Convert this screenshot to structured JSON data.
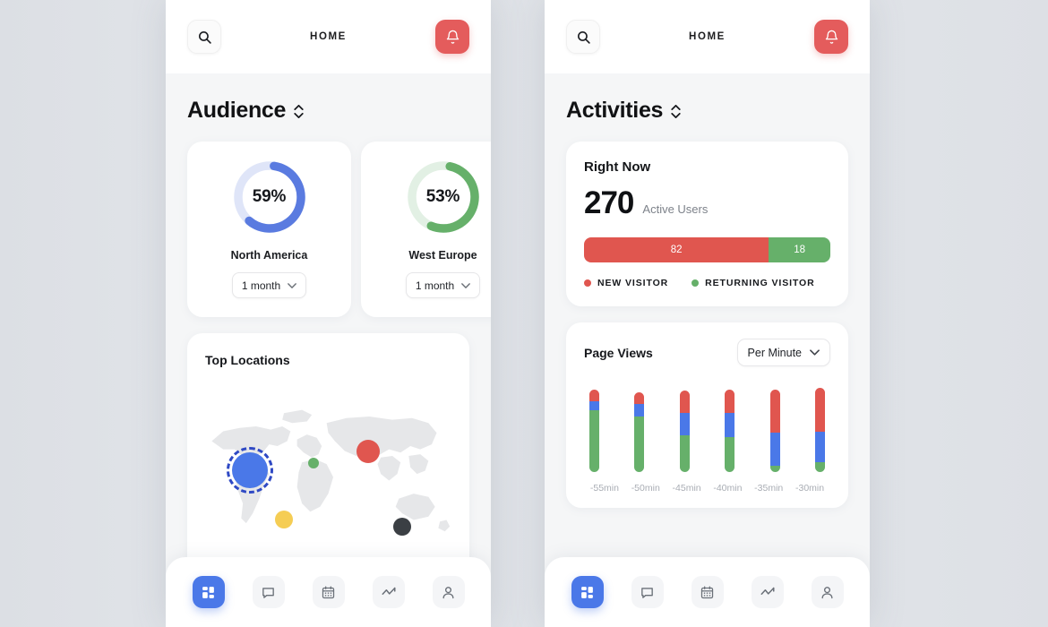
{
  "background_color": "#dfe3e7",
  "accent_colors": {
    "blue": "#5a7be0",
    "blue_track": "#dfe5f8",
    "green": "#66b06a",
    "green_track": "#e2f0e4",
    "red": "#e45c5c",
    "nav_active": "#4a78e8",
    "bar_red": "#e0564f",
    "bar_blue": "#4a78e8",
    "bar_green": "#66b06a"
  },
  "phones": [
    {
      "id": "audience-phone",
      "header": {
        "search_icon": "search-icon",
        "title": "HOME",
        "bell_icon": "bell-icon"
      },
      "section": {
        "title": "Audience",
        "sort_icon": "sort-chevrons-icon"
      },
      "donuts": [
        {
          "percent_label": "59%",
          "value": 59,
          "region": "North America",
          "period": "1 month",
          "color": "#5a7be0",
          "track": "#dfe5f8"
        },
        {
          "percent_label": "53%",
          "value": 53,
          "region": "West Europe",
          "period": "1 month",
          "color": "#66b06a",
          "track": "#e2f0e4"
        }
      ],
      "map_card": {
        "title": "Top Locations",
        "markers": [
          {
            "name": "north-america-marker",
            "color": "#4a78e8",
            "x": 18,
            "y": 50,
            "size": 40,
            "ring": true
          },
          {
            "name": "asia-marker",
            "color": "#e0564f",
            "x": 66,
            "y": 40,
            "size": 26,
            "ring": false
          },
          {
            "name": "west-africa-marker",
            "color": "#66b06a",
            "x": 44,
            "y": 46,
            "size": 12,
            "ring": false
          },
          {
            "name": "south-america-marker",
            "color": "#f5cd54",
            "x": 32,
            "y": 76,
            "size": 20,
            "ring": false
          },
          {
            "name": "australia-marker",
            "color": "#3b3f44",
            "x": 80,
            "y": 80,
            "size": 20,
            "ring": false
          }
        ]
      },
      "bottom_nav": [
        {
          "name": "nav-dashboard",
          "icon": "dashboard-grid-icon",
          "active": true
        },
        {
          "name": "nav-messages",
          "icon": "chat-bubble-icon",
          "active": false
        },
        {
          "name": "nav-calendar",
          "icon": "calendar-icon",
          "active": false
        },
        {
          "name": "nav-analytics",
          "icon": "trend-line-icon",
          "active": false
        },
        {
          "name": "nav-profile",
          "icon": "person-icon",
          "active": false
        }
      ]
    },
    {
      "id": "activities-phone",
      "header": {
        "search_icon": "search-icon",
        "title": "HOME",
        "bell_icon": "bell-icon"
      },
      "section": {
        "title": "Activities",
        "sort_icon": "sort-chevrons-icon"
      },
      "right_now": {
        "title": "Right Now",
        "count": "270",
        "count_caption": "Active Users",
        "bar": [
          {
            "label": "82",
            "value": 82,
            "width_pct": 75,
            "color": "#e0564f"
          },
          {
            "label": "18",
            "value": 18,
            "width_pct": 25,
            "color": "#66b06a"
          }
        ],
        "legend": [
          {
            "label": "NEW VISITOR",
            "color": "#e0564f"
          },
          {
            "label": "RETURNING VISITOR",
            "color": "#66b06a"
          }
        ]
      },
      "page_views": {
        "title": "Page Views",
        "period_select": "Per Minute",
        "chevron_icon": "chevron-down-icon"
      },
      "bottom_nav": [
        {
          "name": "nav-dashboard",
          "icon": "dashboard-grid-icon",
          "active": true
        },
        {
          "name": "nav-messages",
          "icon": "chat-bubble-icon",
          "active": false
        },
        {
          "name": "nav-calendar",
          "icon": "calendar-icon",
          "active": false
        },
        {
          "name": "nav-analytics",
          "icon": "trend-line-icon",
          "active": false
        },
        {
          "name": "nav-profile",
          "icon": "person-icon",
          "active": false
        }
      ]
    }
  ],
  "chart_data": [
    {
      "type": "pie",
      "title": "North America",
      "values": [
        59,
        41
      ],
      "categories": [
        "North America",
        "Remainder"
      ],
      "colors": [
        "#5a7be0",
        "#dfe5f8"
      ],
      "data_label": "59%"
    },
    {
      "type": "pie",
      "title": "West Europe",
      "values": [
        53,
        47
      ],
      "categories": [
        "West Europe",
        "Remainder"
      ],
      "colors": [
        "#66b06a",
        "#e2f0e4"
      ],
      "data_label": "53%"
    },
    {
      "type": "bar",
      "title": "Right Now",
      "orientation": "horizontal-stacked",
      "categories": [
        "NEW VISITOR",
        "RETURNING VISITOR"
      ],
      "values": [
        82,
        18
      ],
      "colors": [
        "#e0564f",
        "#66b06a"
      ],
      "annotation": "270 Active Users"
    },
    {
      "type": "bar",
      "title": "Page Views",
      "subtitle": "Per Minute",
      "stacked": true,
      "xlabel": "",
      "ylabel": "",
      "categories": [
        "-55min",
        "-50min",
        "-45min",
        "-40min",
        "-35min",
        "-30min"
      ],
      "series": [
        {
          "name": "red",
          "color": "#e0564f",
          "values": [
            14,
            15,
            27,
            28,
            52,
            52
          ]
        },
        {
          "name": "blue",
          "color": "#4a78e8",
          "values": [
            11,
            16,
            28,
            30,
            40,
            36
          ]
        },
        {
          "name": "green",
          "color": "#66b06a",
          "values": [
            75,
            69,
            45,
            42,
            8,
            12
          ]
        }
      ],
      "note": "Values are percentages of each bar's total height; bars drawn top=red, middle=blue, bottom=green.",
      "grid": false,
      "legend": "none"
    }
  ]
}
